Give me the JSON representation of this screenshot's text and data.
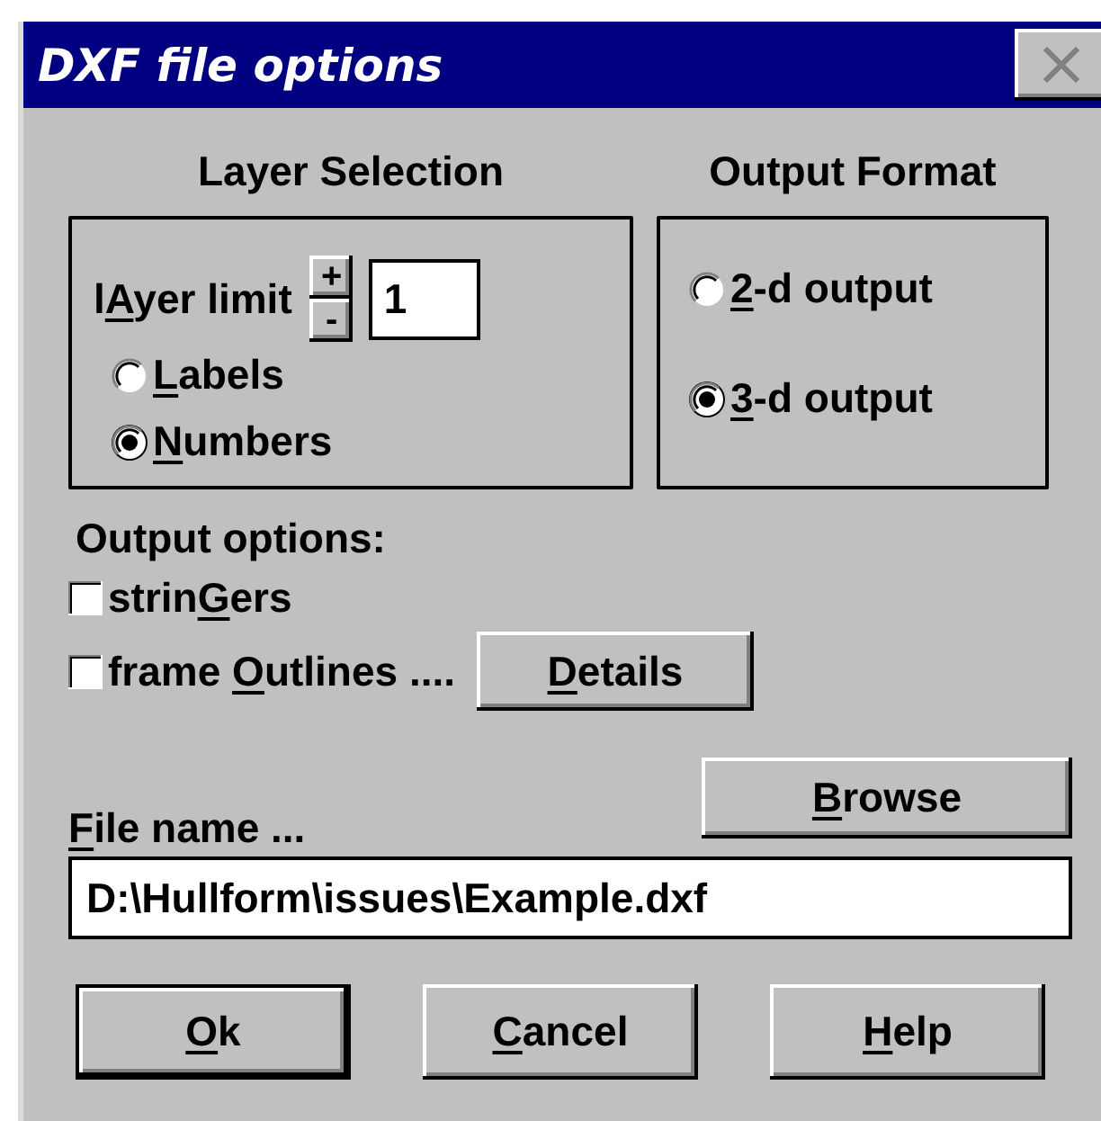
{
  "window": {
    "title": "DXF file options"
  },
  "layer_selection": {
    "heading": "Layer Selection",
    "limit_label": {
      "lead": "l",
      "key": "A",
      "rest": "yer limit"
    },
    "spin_up": "+",
    "spin_down": "-",
    "limit_value": "1",
    "options": [
      {
        "label": {
          "key": "L",
          "rest": "abels"
        },
        "selected": false
      },
      {
        "label": {
          "key": "N",
          "rest": "umbers"
        },
        "selected": true
      }
    ]
  },
  "output_format": {
    "heading": "Output Format",
    "options": [
      {
        "label": {
          "key": "2",
          "rest": "-d output"
        },
        "selected": false
      },
      {
        "label": {
          "key": "3",
          "rest": "-d output"
        },
        "selected": true
      }
    ]
  },
  "output_options": {
    "heading": "Output options:",
    "items": [
      {
        "label": {
          "lead": "strin",
          "key": "G",
          "rest": "ers"
        },
        "checked": false
      },
      {
        "label": {
          "lead": "frame ",
          "key": "O",
          "rest": "utlines ...."
        },
        "checked": false
      }
    ],
    "details_button": {
      "key": "D",
      "rest": "etails"
    }
  },
  "file": {
    "label": {
      "key": "F",
      "rest": "ile name ..."
    },
    "browse_button": {
      "key": "B",
      "rest": "rowse"
    },
    "value": "D:\\Hullform\\issues\\Example.dxf"
  },
  "buttons": [
    {
      "label": {
        "key": "O",
        "rest": "k"
      },
      "default": true
    },
    {
      "label": {
        "key": "C",
        "rest": "ancel"
      },
      "default": false
    },
    {
      "label": {
        "key": "H",
        "rest": "elp"
      },
      "default": false
    }
  ]
}
